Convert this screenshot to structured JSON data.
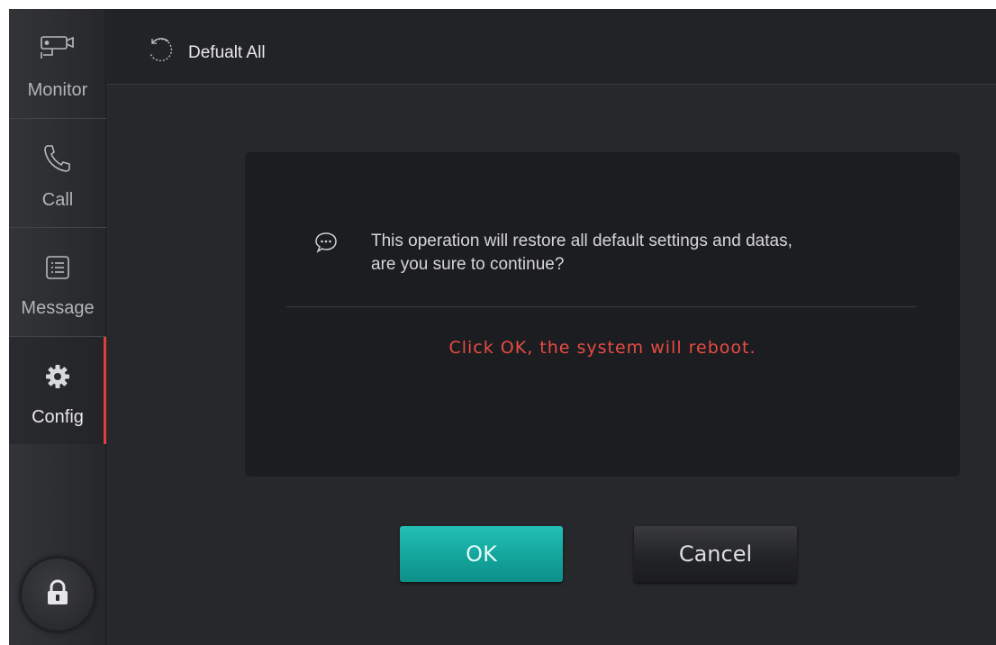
{
  "sidebar": {
    "items": [
      {
        "id": "monitor",
        "label": "Monitor",
        "icon": "camera-icon"
      },
      {
        "id": "call",
        "label": "Call",
        "icon": "phone-icon"
      },
      {
        "id": "message",
        "label": "Message",
        "icon": "message-list-icon"
      },
      {
        "id": "config",
        "label": "Config",
        "icon": "gear-icon",
        "active": true
      }
    ],
    "lock_icon": "lock-icon"
  },
  "header": {
    "title": "Defualt All",
    "icon": "restore-icon"
  },
  "dialog": {
    "icon": "chat-bubble-icon",
    "message_line1": "This operation will restore all default settings and datas,",
    "message_line2": "are you sure to continue?",
    "warning": "Click OK, the system will reboot."
  },
  "buttons": {
    "ok_label": "OK",
    "cancel_label": "Cancel"
  },
  "colors": {
    "accent_active": "#e0403c",
    "warning_text": "#e84b45",
    "ok_button": "#14a79e",
    "background": "#27282b"
  }
}
